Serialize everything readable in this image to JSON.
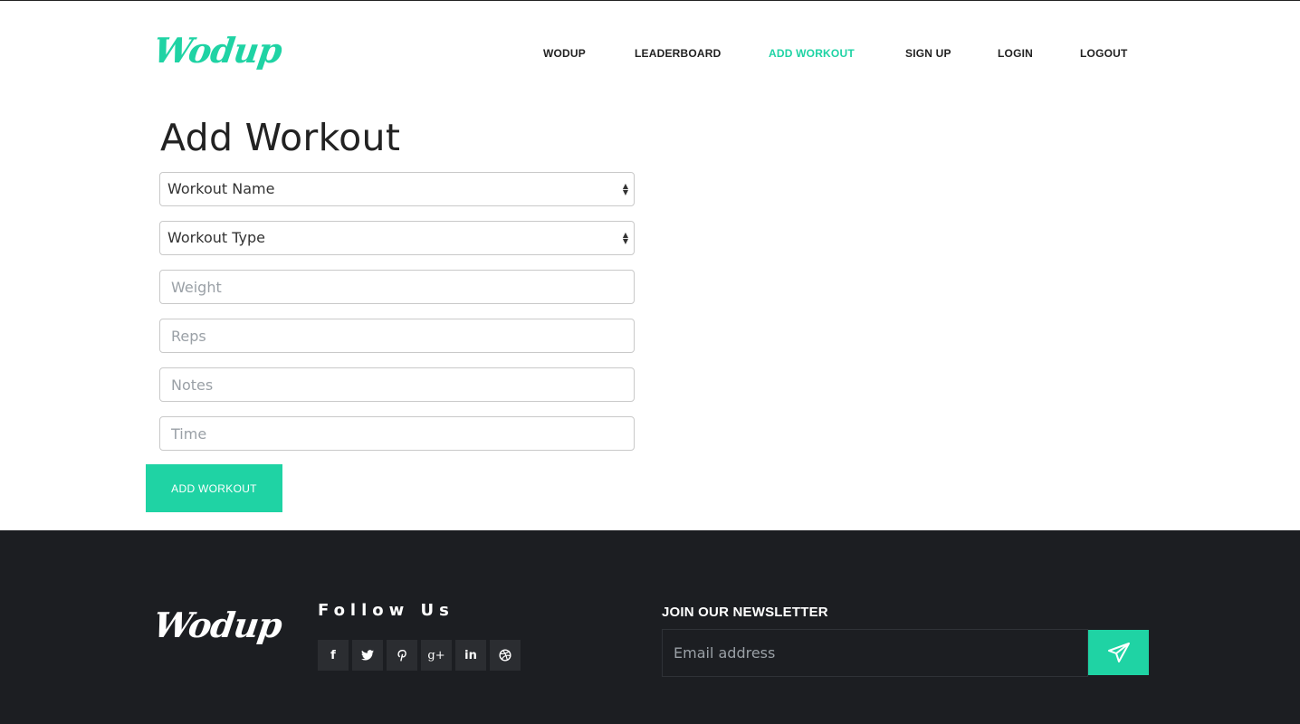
{
  "brand": {
    "name": "Wodup",
    "accent": "#1fd3a4",
    "footer_bg": "#1c1e22"
  },
  "nav": [
    {
      "label": "WODUP",
      "active": false
    },
    {
      "label": "LEADERBOARD",
      "active": false
    },
    {
      "label": "ADD WORKOUT",
      "active": true
    },
    {
      "label": "SIGN UP",
      "active": false
    },
    {
      "label": "LOGIN",
      "active": false
    },
    {
      "label": "LOGOUT",
      "active": false
    }
  ],
  "form": {
    "title": "Add Workout",
    "workout_name": {
      "selected": "Workout Name"
    },
    "workout_type": {
      "selected": "Workout Type"
    },
    "weight_placeholder": "Weight",
    "reps_placeholder": "Reps",
    "notes_placeholder": "Notes",
    "time_placeholder": "Time",
    "submit_label": "ADD WORKOUT"
  },
  "footer": {
    "logo": "Wodup",
    "follow_title": "Follow Us",
    "social": [
      {
        "icon": "facebook-icon",
        "glyph": "f"
      },
      {
        "icon": "twitter-icon",
        "glyph": "🐦"
      },
      {
        "icon": "pinterest-icon",
        "glyph": "P"
      },
      {
        "icon": "google-plus-icon",
        "glyph": "g+"
      },
      {
        "icon": "linkedin-icon",
        "glyph": "in"
      },
      {
        "icon": "dribbble-icon",
        "glyph": "◎"
      }
    ],
    "newsletter_title": "JOIN OUR NEWSLETTER",
    "email_placeholder": "Email address",
    "send_icon": "paper-plane-icon"
  }
}
